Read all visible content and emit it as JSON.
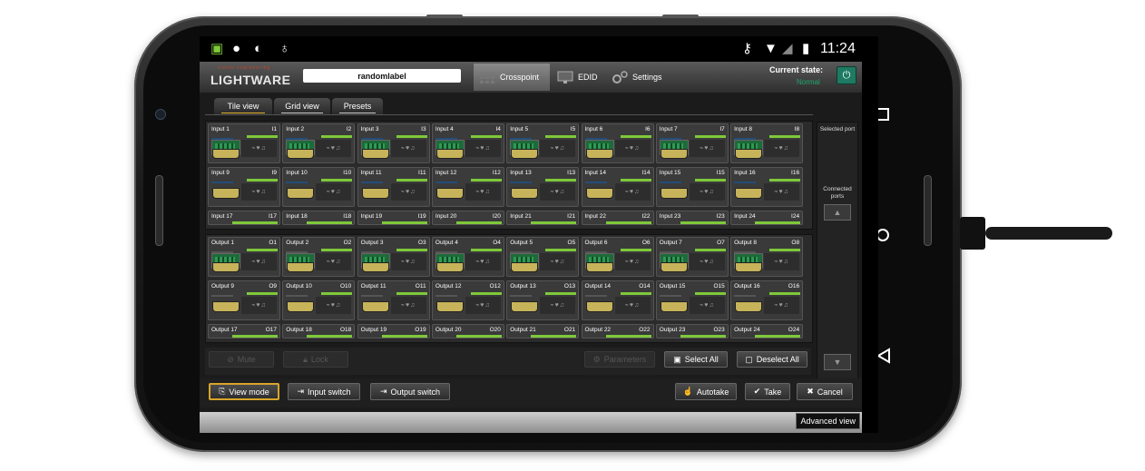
{
  "statusbar": {
    "icons": [
      "android-icon",
      "android-icon",
      "sync-icon",
      "bug-icon"
    ],
    "time": "11:24"
  },
  "header": {
    "logo_sub": "vision engineering",
    "logo_main": "LIGHTWARE",
    "device_label": "randomlabel",
    "tabs": [
      {
        "label": "Crosspoint",
        "icon": "grid-icon",
        "active": true
      },
      {
        "label": "EDID",
        "icon": "monitor-icon",
        "active": false
      },
      {
        "label": "Settings",
        "icon": "gear-icon",
        "active": false
      }
    ],
    "current_state_label": "Current state:",
    "current_state_value": "Normal"
  },
  "view_tabs": [
    {
      "label": "Tile view",
      "active": true
    },
    {
      "label": "Grid view",
      "active": false
    },
    {
      "label": "Presets",
      "active": false
    }
  ],
  "inputs": [
    {
      "name": "Input 1",
      "id": "I1"
    },
    {
      "name": "Input 2",
      "id": "I2"
    },
    {
      "name": "Input 3",
      "id": "I3"
    },
    {
      "name": "Input 4",
      "id": "I4"
    },
    {
      "name": "Input 5",
      "id": "I5"
    },
    {
      "name": "Input 6",
      "id": "I6"
    },
    {
      "name": "Input 7",
      "id": "I7"
    },
    {
      "name": "Input 8",
      "id": "I8"
    },
    {
      "name": "Input 9",
      "id": "I9"
    },
    {
      "name": "Input 10",
      "id": "I10"
    },
    {
      "name": "Input 11",
      "id": "I11"
    },
    {
      "name": "Input 12",
      "id": "I12"
    },
    {
      "name": "Input 13",
      "id": "I13"
    },
    {
      "name": "Input 14",
      "id": "I14"
    },
    {
      "name": "Input 15",
      "id": "I15"
    },
    {
      "name": "Input 16",
      "id": "I16"
    },
    {
      "name": "Input 17",
      "id": "I17"
    },
    {
      "name": "Input 18",
      "id": "I18"
    },
    {
      "name": "Input 19",
      "id": "I19"
    },
    {
      "name": "Input 20",
      "id": "I20"
    },
    {
      "name": "Input 21",
      "id": "I21"
    },
    {
      "name": "Input 22",
      "id": "I22"
    },
    {
      "name": "Input 23",
      "id": "I23"
    },
    {
      "name": "Input 24",
      "id": "I24"
    }
  ],
  "outputs": [
    {
      "name": "Output 1",
      "id": "O1"
    },
    {
      "name": "Output 2",
      "id": "O2"
    },
    {
      "name": "Output 3",
      "id": "O3"
    },
    {
      "name": "Output 4",
      "id": "O4"
    },
    {
      "name": "Output 5",
      "id": "O5"
    },
    {
      "name": "Output 6",
      "id": "O6"
    },
    {
      "name": "Output 7",
      "id": "O7"
    },
    {
      "name": "Output 8",
      "id": "O8"
    },
    {
      "name": "Output 9",
      "id": "O9"
    },
    {
      "name": "Output 10",
      "id": "O10"
    },
    {
      "name": "Output 11",
      "id": "O11"
    },
    {
      "name": "Output 12",
      "id": "O12"
    },
    {
      "name": "Output 13",
      "id": "O13"
    },
    {
      "name": "Output 14",
      "id": "O14"
    },
    {
      "name": "Output 15",
      "id": "O15"
    },
    {
      "name": "Output 16",
      "id": "O16"
    },
    {
      "name": "Output 17",
      "id": "O17"
    },
    {
      "name": "Output 18",
      "id": "O18"
    },
    {
      "name": "Output 19",
      "id": "O19"
    },
    {
      "name": "Output 20",
      "id": "O20"
    },
    {
      "name": "Output 21",
      "id": "O21"
    },
    {
      "name": "Output 22",
      "id": "O22"
    },
    {
      "name": "Output 23",
      "id": "O23"
    },
    {
      "name": "Output 24",
      "id": "O24"
    }
  ],
  "side_panel": {
    "selected_port": "Selected port",
    "connected_ports": "Connected ports"
  },
  "actions": {
    "mute": "Mute",
    "lock": "Lock",
    "parameters": "Parameters",
    "select_all": "Select All",
    "deselect_all": "Deselect All"
  },
  "modes": {
    "view_mode": "View mode",
    "input_switch": "Input switch",
    "output_switch": "Output switch",
    "autotake": "Autotake",
    "take": "Take",
    "cancel": "Cancel"
  },
  "footer": {
    "advanced_view": "Advanced view"
  },
  "colors": {
    "accent_green": "#7ec83a",
    "selected_border": "#d8a42a",
    "state_green": "#1aa86b"
  }
}
